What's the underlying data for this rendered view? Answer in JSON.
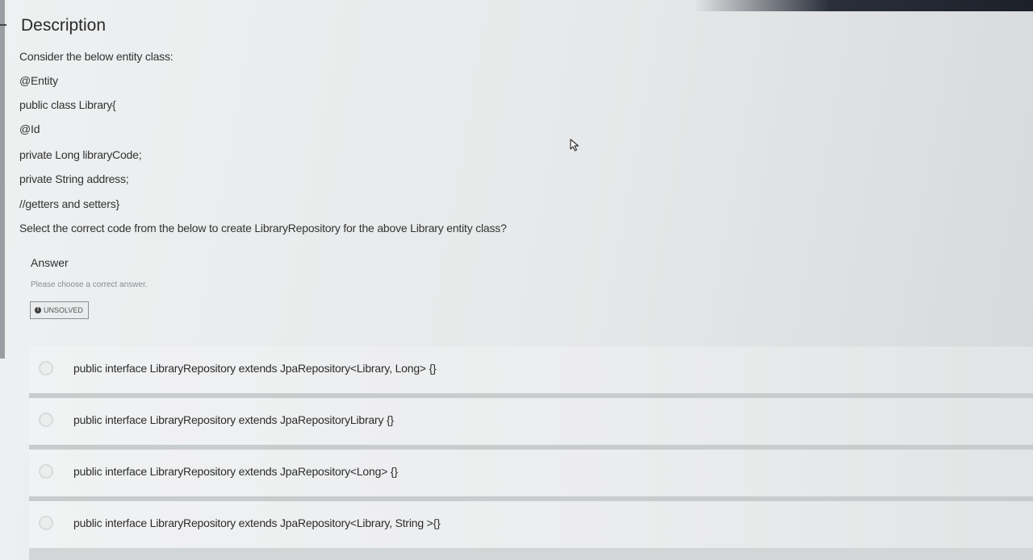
{
  "question": {
    "title": "Description",
    "lines": [
      "Consider the below entity class:",
      "@Entity",
      "public class Library{",
      "@Id",
      "private Long libraryCode;",
      "private String address;",
      "//getters and setters}",
      "Select the correct code from the below to create LibraryRepository for the above Library entity class?"
    ]
  },
  "answer": {
    "label": "Answer",
    "hint": "Please choose a correct answer.",
    "status": "UNSOLVED",
    "status_icon": "info-icon"
  },
  "options": [
    "public interface LibraryRepository extends JpaRepository<Library, Long> {}",
    "public interface LibraryRepository extends JpaRepositoryLibrary {}",
    "public interface LibraryRepository extends JpaRepository<Long> {}",
    "public interface LibraryRepository extends JpaRepository<Library, String >{}"
  ],
  "colors": {
    "background": "#e6e8e9",
    "option_bg": "#eeeff0",
    "text": "#2b2b2b"
  }
}
